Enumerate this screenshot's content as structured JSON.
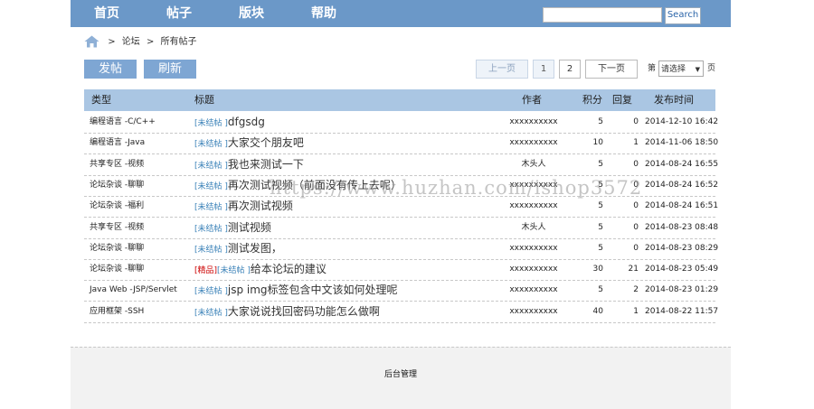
{
  "nav": {
    "items": [
      "首页",
      "帖子",
      "版块",
      "帮助"
    ],
    "search_placeholder": "",
    "search_button": "Search"
  },
  "breadcrumb": {
    "items": [
      "论坛",
      "所有帖子"
    ],
    "separator": ">"
  },
  "actions": {
    "post_label": "发帖",
    "refresh_label": "刷新"
  },
  "pager": {
    "prev_label": "上一页",
    "pages": [
      "1",
      "2"
    ],
    "next_label": "下一页",
    "jump_prefix": "第",
    "jump_select": "请选择",
    "jump_suffix": "页"
  },
  "table": {
    "headers": {
      "type": "类型",
      "title": "标题",
      "author": "作者",
      "score": "积分",
      "reply": "回复",
      "date": "发布时间"
    },
    "rows": [
      {
        "type": "编程语言 -C/C++",
        "tags": [
          "[未结帖 ]"
        ],
        "title": "dfgsdg",
        "author": "xxxxxxxxxx",
        "score": "5",
        "reply": "0",
        "date": "2014-12-10 16:42"
      },
      {
        "type": "编程语言 -Java",
        "tags": [
          "[未结帖 ]"
        ],
        "title": "大家交个朋友吧",
        "author": "xxxxxxxxxx",
        "score": "10",
        "reply": "1",
        "date": "2014-11-06 18:50"
      },
      {
        "type": "共享专区 -视频",
        "tags": [
          "[未结帖 ]"
        ],
        "title": "我也来测试一下",
        "author": "木头人",
        "score": "5",
        "reply": "0",
        "date": "2014-08-24 16:55"
      },
      {
        "type": "论坛杂谈 -聊聊",
        "tags": [
          "[未结帖 ]"
        ],
        "title": "再次测试视频（前面没有传上去呢）",
        "author": "xxxxxxxxxx",
        "score": "5",
        "reply": "0",
        "date": "2014-08-24 16:52"
      },
      {
        "type": "论坛杂谈 -福利",
        "tags": [
          "[未结帖 ]"
        ],
        "title": "再次测试视频",
        "author": "xxxxxxxxxx",
        "score": "5",
        "reply": "0",
        "date": "2014-08-24 16:51"
      },
      {
        "type": "共享专区 -视频",
        "tags": [
          "[未结帖 ]"
        ],
        "title": "测试视频",
        "author": "木头人",
        "score": "5",
        "reply": "0",
        "date": "2014-08-23 08:48"
      },
      {
        "type": "论坛杂谈 -聊聊",
        "tags": [
          "[未结帖 ]"
        ],
        "title": "测试发图，",
        "author": "xxxxxxxxxx",
        "score": "5",
        "reply": "0",
        "date": "2014-08-23 08:29"
      },
      {
        "type": "论坛杂谈 -聊聊",
        "tags": [
          "[精品]",
          "[未结帖 ]"
        ],
        "title": "给本论坛的建议",
        "author": "xxxxxxxxxx",
        "score": "30",
        "reply": "21",
        "date": "2014-08-23 05:49"
      },
      {
        "type": "Java Web -JSP/Servlet",
        "tags": [
          "[未结帖 ]"
        ],
        "title": "jsp img标签包含中文该如何处理呢",
        "author": "xxxxxxxxxx",
        "score": "5",
        "reply": "2",
        "date": "2014-08-23 01:29"
      },
      {
        "type": "应用框架 -SSH",
        "tags": [
          "[未结帖 ]"
        ],
        "title": "大家说说找回密码功能怎么做啊",
        "author": "xxxxxxxxxx",
        "score": "40",
        "reply": "1",
        "date": "2014-08-22 11:57"
      }
    ]
  },
  "footer": {
    "admin_link": "后台管理"
  },
  "watermark": "https://www.huzhan.com/ishop3572",
  "colors": {
    "nav_bg": "#6b98c8",
    "header_bg": "#aac6e3",
    "button_bg": "#7ea6d3",
    "tag_blue": "#3b82b8",
    "tag_red": "#cc0000"
  }
}
